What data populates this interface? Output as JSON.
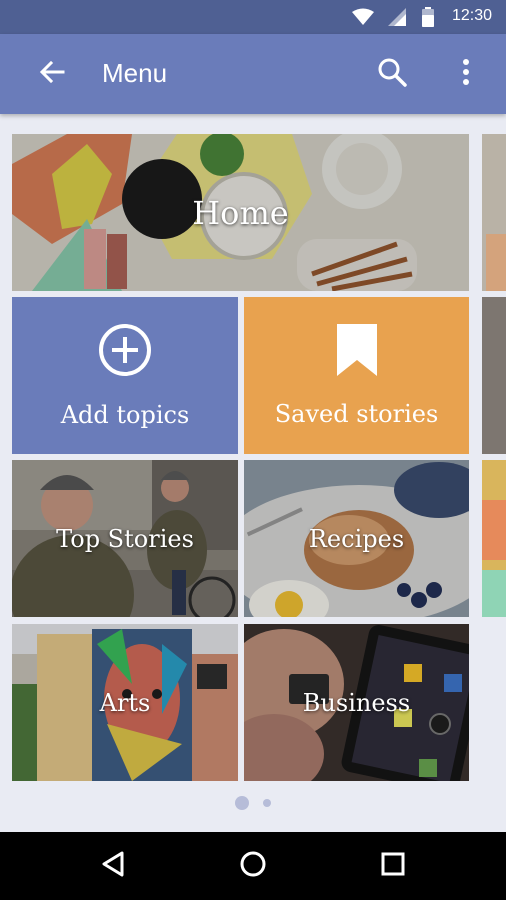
{
  "status_bar": {
    "time": "12:30",
    "icons": [
      "wifi-icon",
      "cell-signal-icon",
      "battery-icon"
    ]
  },
  "app_bar": {
    "title": "Menu",
    "icons": [
      "back-arrow-icon",
      "search-icon",
      "more-vert-icon"
    ]
  },
  "tiles": {
    "home": "Home",
    "add_topics": "Add topics",
    "saved_stories": "Saved stories",
    "top_stories": "Top Stories",
    "recipes": "Recipes",
    "arts": "Arts",
    "business": "Business"
  },
  "colors": {
    "status_bar": "#4f6093",
    "app_bar": "#6a7cba",
    "add_topics": "#6a7cba",
    "saved_stories": "#e8a24f",
    "background": "#e9ebf3"
  },
  "page_indicator": {
    "pages": 2,
    "current": 1
  },
  "nav_bar": {
    "icons": [
      "back-triangle-icon",
      "home-circle-icon",
      "recents-square-icon"
    ]
  }
}
